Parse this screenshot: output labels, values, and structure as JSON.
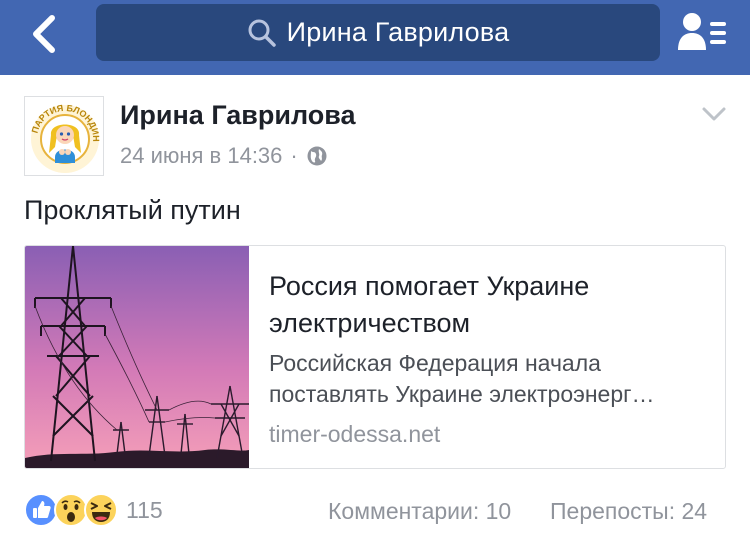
{
  "header": {
    "search_value": "Ирина Гаврилова",
    "brand_color": "#4267b2",
    "search_bg_color": "#29487d",
    "icons": {
      "back": "chevron-left-icon",
      "search": "search-icon",
      "friends": "friend-requests-icon"
    }
  },
  "post": {
    "author": "Ирина Гаврилова",
    "date": "24 июня в 14:36",
    "separator": "·",
    "privacy_icon": "globe-icon",
    "text": "Проклятый путин",
    "avatar_text": "ПАРТИЯ БЛОНДИНОК",
    "link": {
      "title": "Россия помогает Украине электричеством",
      "description": "Российская Федерация начала поставлять Украине электроэнерг…",
      "domain": "timer-odessa.net"
    },
    "footer": {
      "reaction_icons": [
        "like-icon",
        "wow-icon",
        "haha-icon"
      ],
      "reaction_count": "115",
      "comments": "Комментарии: 10",
      "shares": "Перепосты: 24"
    }
  }
}
